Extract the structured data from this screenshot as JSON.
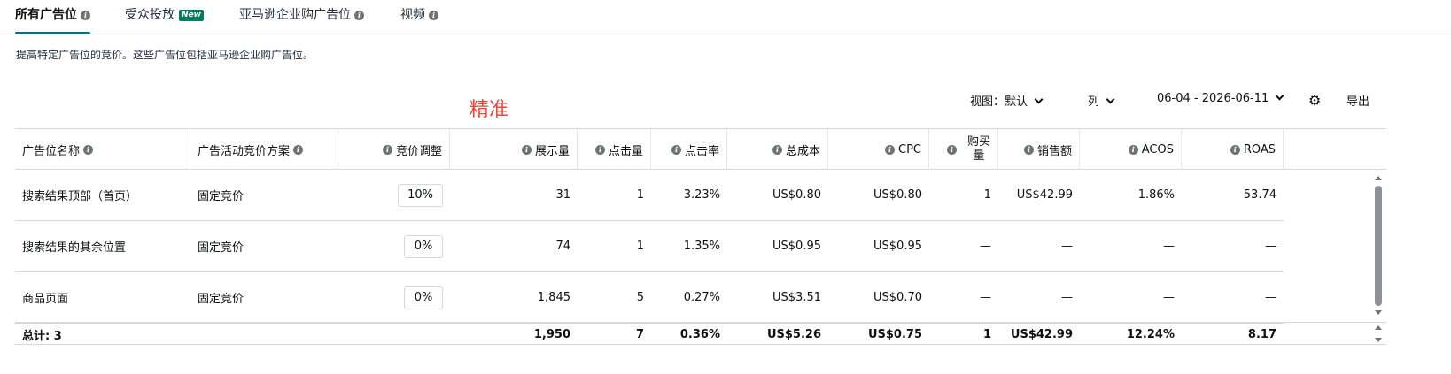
{
  "tabs": [
    {
      "label": "所有广告位",
      "active": true,
      "info": true,
      "badge": ""
    },
    {
      "label": "受众投放",
      "active": false,
      "info": false,
      "badge": "New"
    },
    {
      "label": "亚马逊企业购广告位",
      "active": false,
      "info": true,
      "badge": ""
    },
    {
      "label": "视频",
      "active": false,
      "info": true,
      "badge": ""
    }
  ],
  "description": "提高特定广告位的竞价。这些广告位包括亚马逊企业购广告位。",
  "annotation": "精准",
  "toolbar": {
    "view_label": "视图：默认",
    "columns_label": "列",
    "date_range": "06-04 - 2026-06-11",
    "export_label": "导出"
  },
  "headers": {
    "placement": "广告位名称",
    "strategy": "广告活动竞价方案",
    "bid_adjust": "竞价调整",
    "impressions": "展示量",
    "clicks": "点击量",
    "ctr": "点击率",
    "spend": "总成本",
    "cpc": "CPC",
    "orders_line1": "购买",
    "orders_line2": "量",
    "sales": "销售额",
    "acos": "ACOS",
    "roas": "ROAS"
  },
  "rows": [
    {
      "placement": "搜索结果顶部（首页）",
      "strategy": "固定竞价",
      "bid_adjust": "10%",
      "impressions": "31",
      "clicks": "1",
      "ctr": "3.23%",
      "spend": "US$0.80",
      "cpc": "US$0.80",
      "orders": "1",
      "sales": "US$42.99",
      "acos": "1.86%",
      "roas": "53.74"
    },
    {
      "placement": "搜索结果的其余位置",
      "strategy": "固定竞价",
      "bid_adjust": "0%",
      "impressions": "74",
      "clicks": "1",
      "ctr": "1.35%",
      "spend": "US$0.95",
      "cpc": "US$0.95",
      "orders": "—",
      "sales": "—",
      "acos": "—",
      "roas": "—"
    },
    {
      "placement": "商品页面",
      "strategy": "固定竞价",
      "bid_adjust": "0%",
      "impressions": "1,845",
      "clicks": "5",
      "ctr": "0.27%",
      "spend": "US$3.51",
      "cpc": "US$0.70",
      "orders": "—",
      "sales": "—",
      "acos": "—",
      "roas": "—"
    }
  ],
  "totals": {
    "label": "总计: 3",
    "impressions": "1,950",
    "clicks": "7",
    "ctr": "0.36%",
    "spend": "US$5.26",
    "cpc": "US$0.75",
    "orders": "1",
    "sales": "US$42.99",
    "acos": "12.24%",
    "roas": "8.17"
  },
  "icons": {
    "info": "info-icon",
    "settings": "gear-icon",
    "chevron": "chevron-down-icon"
  },
  "colors": {
    "tab_underline": "#007185",
    "new_badge": "#067d62",
    "annotation": "#e8473a"
  }
}
